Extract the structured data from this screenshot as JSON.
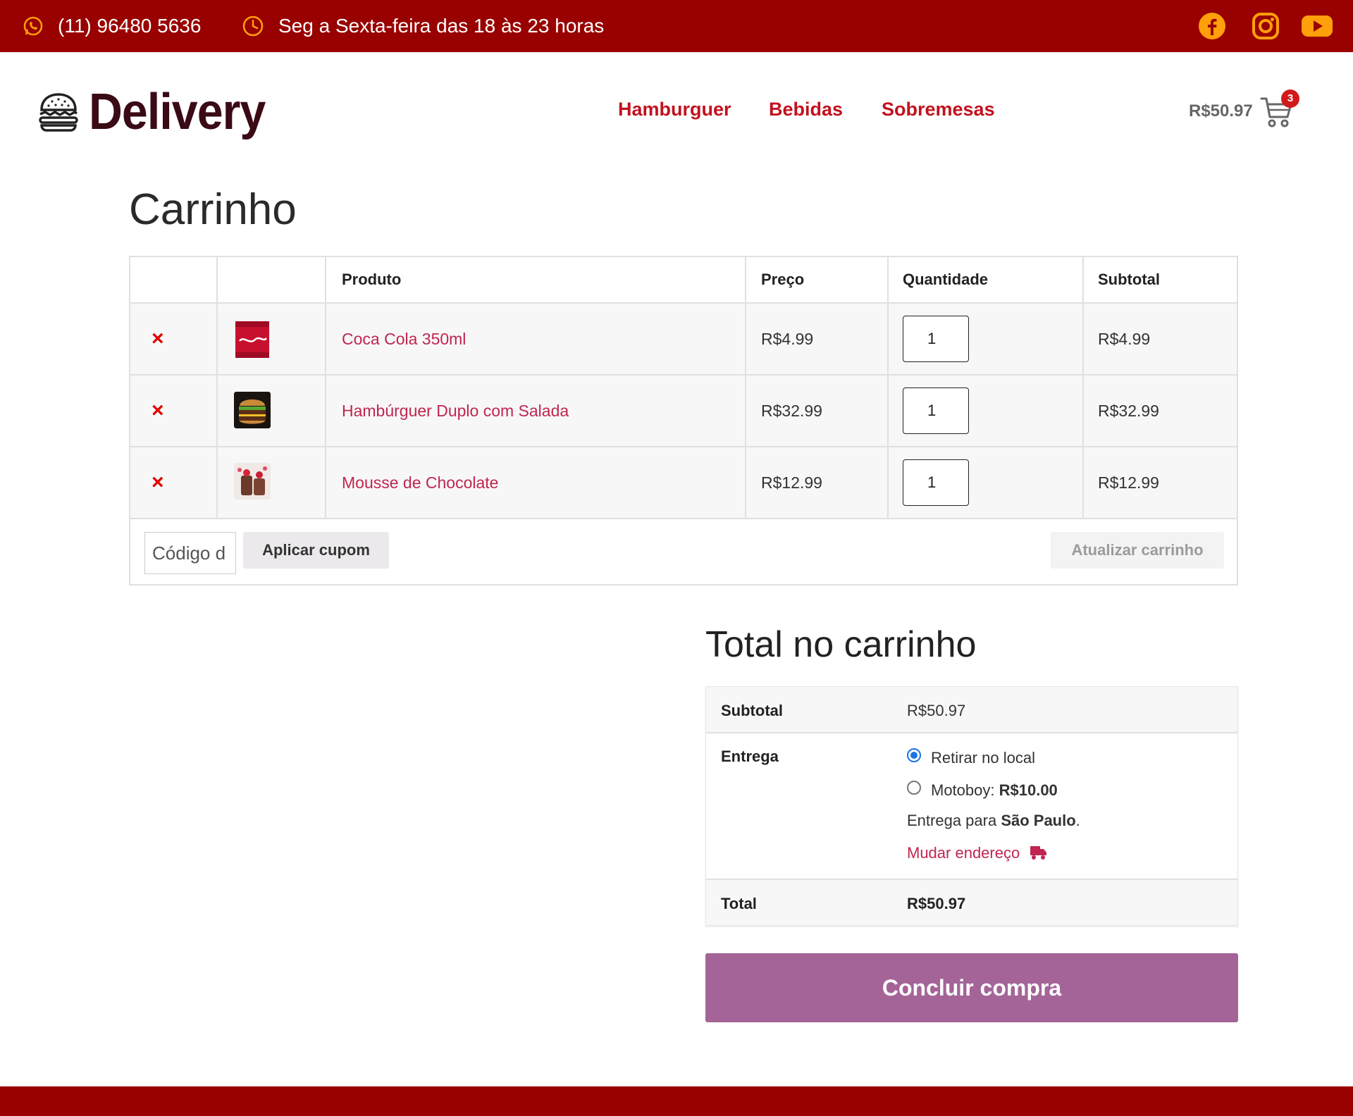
{
  "topbar": {
    "phone": "(11) 96480 5636",
    "hours": "Seg a Sexta-feira das 18 às 23 horas",
    "social": [
      "facebook-icon",
      "instagram-icon",
      "youtube-icon"
    ],
    "color": "#990000",
    "icon_color": "#ff9f0a"
  },
  "header": {
    "logo_text": "Delivery",
    "nav": [
      "Hamburguer",
      "Bebidas",
      "Sobremesas"
    ],
    "cart_total": "R$50.97",
    "cart_count": "3"
  },
  "page_title": "Carrinho",
  "cart": {
    "headers": [
      "",
      "",
      "Produto",
      "Preço",
      "Quantidade",
      "Subtotal"
    ],
    "remove_symbol": "×",
    "items": [
      {
        "name": "Coca Cola 350ml",
        "price": "R$4.99",
        "qty": "1",
        "subtotal": "R$4.99",
        "thumb": "coca-cola-can-image"
      },
      {
        "name": "Hambúrguer Duplo com Salada",
        "price": "R$32.99",
        "qty": "1",
        "subtotal": "R$32.99",
        "thumb": "burger-image"
      },
      {
        "name": "Mousse de Chocolate",
        "price": "R$12.99",
        "qty": "1",
        "subtotal": "R$12.99",
        "thumb": "mousse-image"
      }
    ],
    "coupon_placeholder": "Código d",
    "apply_coupon": "Aplicar cupom",
    "update_cart": "Atualizar carrinho"
  },
  "totals": {
    "title": "Total no carrinho",
    "subtotal_label": "Subtotal",
    "subtotal_value": "R$50.97",
    "shipping_label": "Entrega",
    "option1": "Retirar no local",
    "option2_label": "Motoboy: ",
    "option2_price": "R$10.00",
    "ship_to_prefix": "Entrega para ",
    "ship_to_city": "São Paulo",
    "ship_to_suffix": ".",
    "change_address": "Mudar endereço",
    "total_label": "Total",
    "total_value": "R$50.97"
  },
  "checkout_button": "Concluir compra",
  "colors": {
    "brand_red": "#990000",
    "link": "#c0264f",
    "nav": "#c1121f",
    "checkout": "#a46497"
  }
}
